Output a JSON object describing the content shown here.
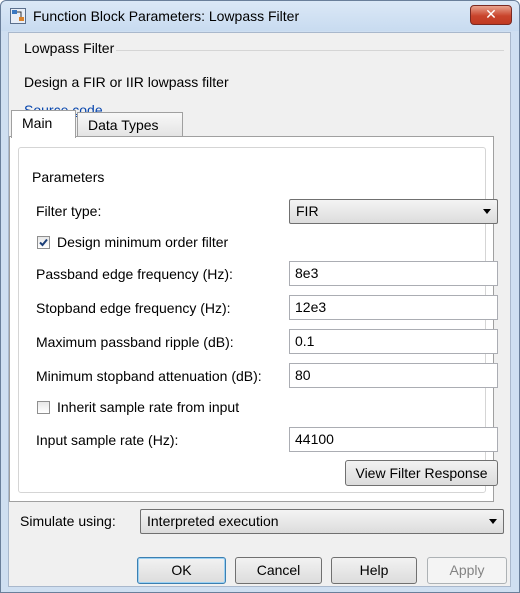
{
  "window": {
    "title": "Function Block Parameters: Lowpass Filter",
    "close_label": "✕"
  },
  "header": {
    "group_title": "Lowpass Filter",
    "description": "Design a FIR or IIR lowpass filter",
    "source_link": "Source code"
  },
  "tabs": [
    {
      "label": "Main",
      "active": true
    },
    {
      "label": "Data Types",
      "active": false
    }
  ],
  "parameters": {
    "group_title": "Parameters",
    "filter_type": {
      "label": "Filter type:",
      "value": "FIR"
    },
    "design_min_order": {
      "label": "Design minimum order filter",
      "checked": true
    },
    "passband_edge": {
      "label": "Passband edge frequency (Hz):",
      "value": "8e3"
    },
    "stopband_edge": {
      "label": "Stopband edge frequency (Hz):",
      "value": "12e3"
    },
    "max_passband_ripple": {
      "label": "Maximum passband ripple (dB):",
      "value": "0.1"
    },
    "min_stopband_atten": {
      "label": "Minimum stopband attenuation (dB):",
      "value": "80"
    },
    "inherit_sample_rate": {
      "label": "Inherit sample rate from input",
      "checked": false
    },
    "input_sample_rate": {
      "label": "Input sample rate (Hz):",
      "value": "44100"
    },
    "view_response_label": "View Filter Response"
  },
  "simulate": {
    "label": "Simulate using:",
    "value": "Interpreted execution"
  },
  "buttons": {
    "ok": "OK",
    "cancel": "Cancel",
    "help": "Help",
    "apply": "Apply"
  }
}
